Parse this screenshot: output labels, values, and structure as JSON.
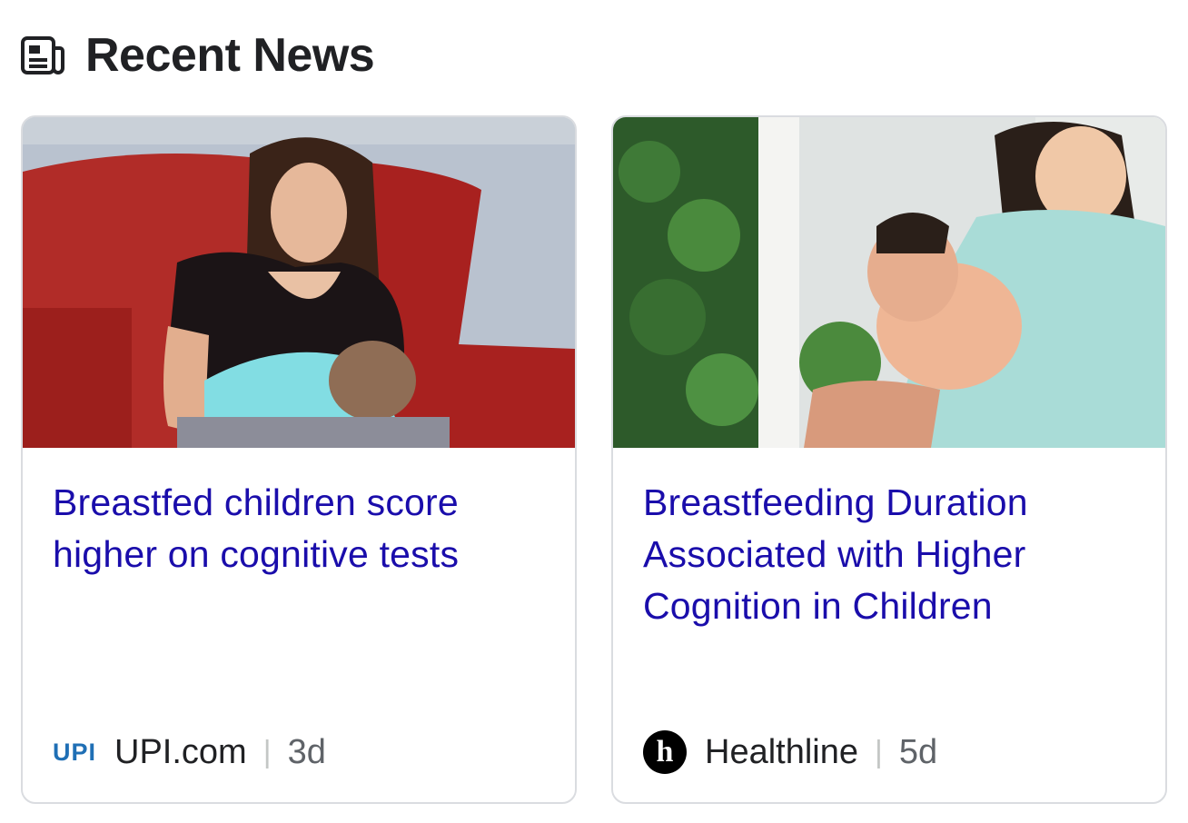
{
  "section": {
    "title": "Recent News",
    "icon": "newspaper-icon"
  },
  "articles": [
    {
      "headline": "Breastfed children score higher on cognitive tests",
      "source": "UPI.com",
      "source_logo_text": "UPI",
      "age": "3d"
    },
    {
      "headline": "Breastfeeding Duration Associated with Higher Cognition in Children",
      "source": "Healthline",
      "source_logo_text": "h",
      "age": "5d"
    }
  ],
  "colors": {
    "headline": "#1a0dab",
    "source_text": "#202124",
    "age_text": "#5f6368",
    "card_border": "#dadce0",
    "upi_brand": "#1f6fb5"
  }
}
